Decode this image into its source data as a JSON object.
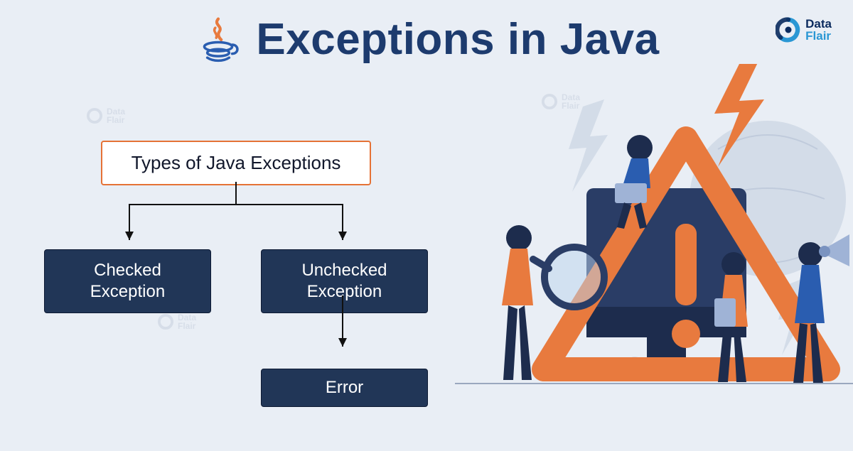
{
  "title": "Exceptions in Java",
  "brand": {
    "line1": "Data",
    "line2": "Flair"
  },
  "diagram": {
    "root": "Types of Java Exceptions",
    "children": [
      "Checked\nException",
      "Unchecked\nException"
    ],
    "grandchild": "Error"
  },
  "colors": {
    "bg": "#e9eef5",
    "title": "#1d3b6e",
    "root_border": "#e57236",
    "node_bg": "#213657",
    "accent_orange": "#e87a3e",
    "accent_blue": "#2a97d4"
  }
}
